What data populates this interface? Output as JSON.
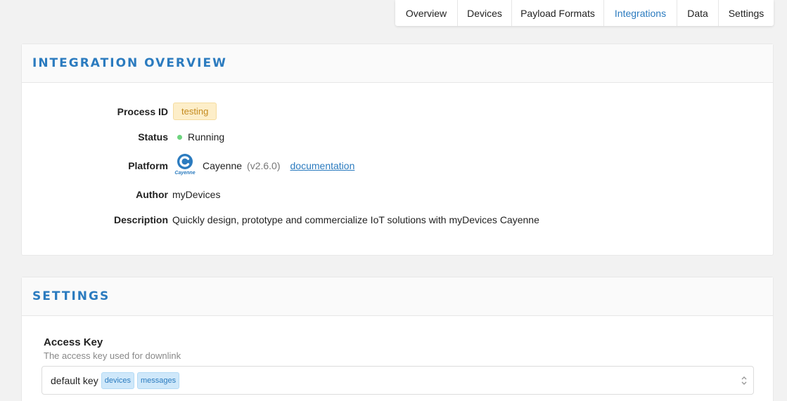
{
  "tabs": [
    {
      "label": "Overview",
      "active": false
    },
    {
      "label": "Devices",
      "active": false
    },
    {
      "label": "Payload Formats",
      "active": false
    },
    {
      "label": "Integrations",
      "active": true
    },
    {
      "label": "Data",
      "active": false
    },
    {
      "label": "Settings",
      "active": false
    }
  ],
  "overview": {
    "title": "INTEGRATION OVERVIEW",
    "process_id_label": "Process ID",
    "process_id": "testing",
    "status_label": "Status",
    "status": "Running",
    "platform_label": "Platform",
    "platform_name": "Cayenne",
    "platform_version": "(v2.6.0)",
    "platform_logo_text": "Cayenne",
    "documentation_link": "documentation",
    "author_label": "Author",
    "author": "myDevices",
    "description_label": "Description",
    "description": "Quickly design, prototype and commercialize IoT solutions with myDevices Cayenne"
  },
  "settings": {
    "title": "SETTINGS",
    "access_key_label": "Access Key",
    "access_key_description": "The access key used for downlink",
    "access_key_value": "default key",
    "access_key_rights": [
      "devices",
      "messages"
    ]
  },
  "colors": {
    "accent": "#2b7bbf",
    "status_running": "#6dd47e",
    "process_badge_bg": "#fdeec9"
  }
}
